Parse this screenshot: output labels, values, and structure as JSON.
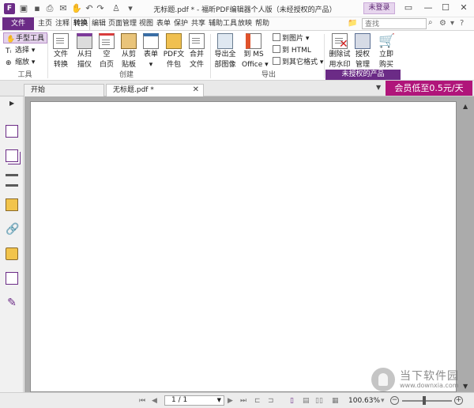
{
  "window": {
    "title": "无标题.pdf * - 福昕PDF编辑器个人版（未经授权的产品）",
    "login_label": "未登录"
  },
  "menu": {
    "file": "文件",
    "items": [
      "主页",
      "注释",
      "转换",
      "编辑",
      "页面管理",
      "视图",
      "表单",
      "保护",
      "共享",
      "辅助工具",
      "放映",
      "帮助"
    ],
    "active": "转换",
    "search_placeholder": "查找"
  },
  "ribbon": {
    "tools": {
      "hand": "手型工具",
      "select": "选择",
      "zoom": "缩放",
      "group": "工具"
    },
    "create": {
      "buttons": [
        {
          "line1": "文件",
          "line2": "转换"
        },
        {
          "line1": "从扫",
          "line2": "描仪"
        },
        {
          "line1": "空",
          "line2": "白页"
        },
        {
          "line1": "从剪",
          "line2": "贴板"
        },
        {
          "line1": "表单",
          "line2": ""
        },
        {
          "line1": "PDF文",
          "line2": "件包"
        },
        {
          "line1": "合并",
          "line2": "文件"
        }
      ],
      "group": "创建"
    },
    "export": {
      "export_all_images": {
        "line1": "导出全",
        "line2": "部图像"
      },
      "to_ms_office": {
        "line1": "到 MS",
        "line2": "Office"
      },
      "to_image": "到图片",
      "to_html": "到 HTML",
      "to_other": "到其它格式",
      "group": "导出"
    },
    "unauthorized": {
      "remove_watermark": {
        "line1": "删除试",
        "line2": "用水印"
      },
      "license_mgmt": {
        "line1": "授权",
        "line2": "管理"
      },
      "buy_now": {
        "line1": "立即",
        "line2": "购买"
      },
      "group": "未授权的产品"
    }
  },
  "tabs": {
    "start": "开始",
    "document": "无标题.pdf *",
    "promo": "会员低至0.5元/天"
  },
  "status": {
    "page_indicator": "1 / 1",
    "zoom": "100.63%",
    "zoom_level": 0.45
  },
  "watermark": {
    "name": "当下软件园",
    "url": "www.downxia.com"
  },
  "colors": {
    "brand": "#6b2b86",
    "promo": "#b0157a"
  }
}
